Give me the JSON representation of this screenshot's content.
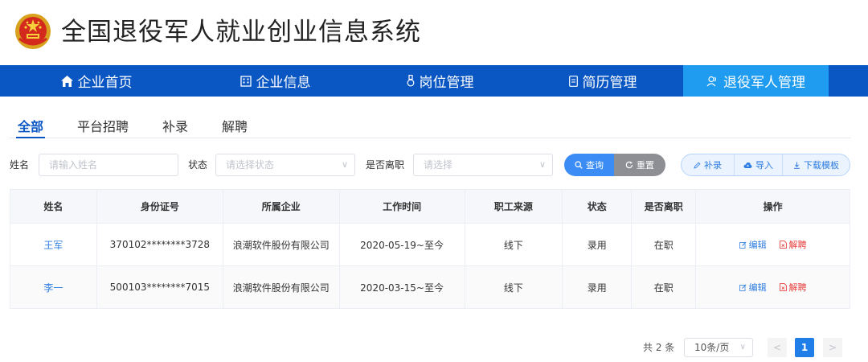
{
  "header": {
    "title": "全国退役军人就业创业信息系统"
  },
  "nav": [
    {
      "label": "企业首页",
      "icon": "home-icon"
    },
    {
      "label": "企业信息",
      "icon": "building-icon"
    },
    {
      "label": "岗位管理",
      "icon": "badge-icon"
    },
    {
      "label": "简历管理",
      "icon": "document-icon"
    },
    {
      "label": "退役军人管理",
      "icon": "users-icon",
      "active": true
    }
  ],
  "tabs": [
    "全部",
    "平台招聘",
    "补录",
    "解聘"
  ],
  "filters": {
    "name_label": "姓名",
    "name_placeholder": "请输入姓名",
    "status_label": "状态",
    "status_placeholder": "请选择状态",
    "resigned_label": "是否离职",
    "resigned_placeholder": "请选择",
    "query_label": "查询",
    "reset_label": "重置",
    "supplement_label": "补录",
    "import_label": "导入",
    "download_label": "下载模板"
  },
  "table": {
    "columns": [
      "姓名",
      "身份证号",
      "所属企业",
      "工作时间",
      "职工来源",
      "状态",
      "是否离职",
      "操作"
    ],
    "rows": [
      {
        "name": "王军",
        "id": "370102********3728",
        "company": "浪潮软件股份有限公司",
        "period": "2020-05-19~至今",
        "source": "线下",
        "status": "录用",
        "resigned": "在职"
      },
      {
        "name": "李一",
        "id": "500103********7015",
        "company": "浪潮软件股份有限公司",
        "period": "2020-03-15~至今",
        "source": "线下",
        "status": "录用",
        "resigned": "在职"
      }
    ],
    "edit_label": "编辑",
    "fire_label": "解聘"
  },
  "pagination": {
    "total": "共 2 条",
    "page_size": "10条/页",
    "prev": "<",
    "current": "1",
    "next": ">"
  },
  "colors": {
    "nav_bg": "#0a57c4",
    "nav_active": "#1f9cf0",
    "link": "#2f7de1",
    "danger": "#e83c3c"
  }
}
